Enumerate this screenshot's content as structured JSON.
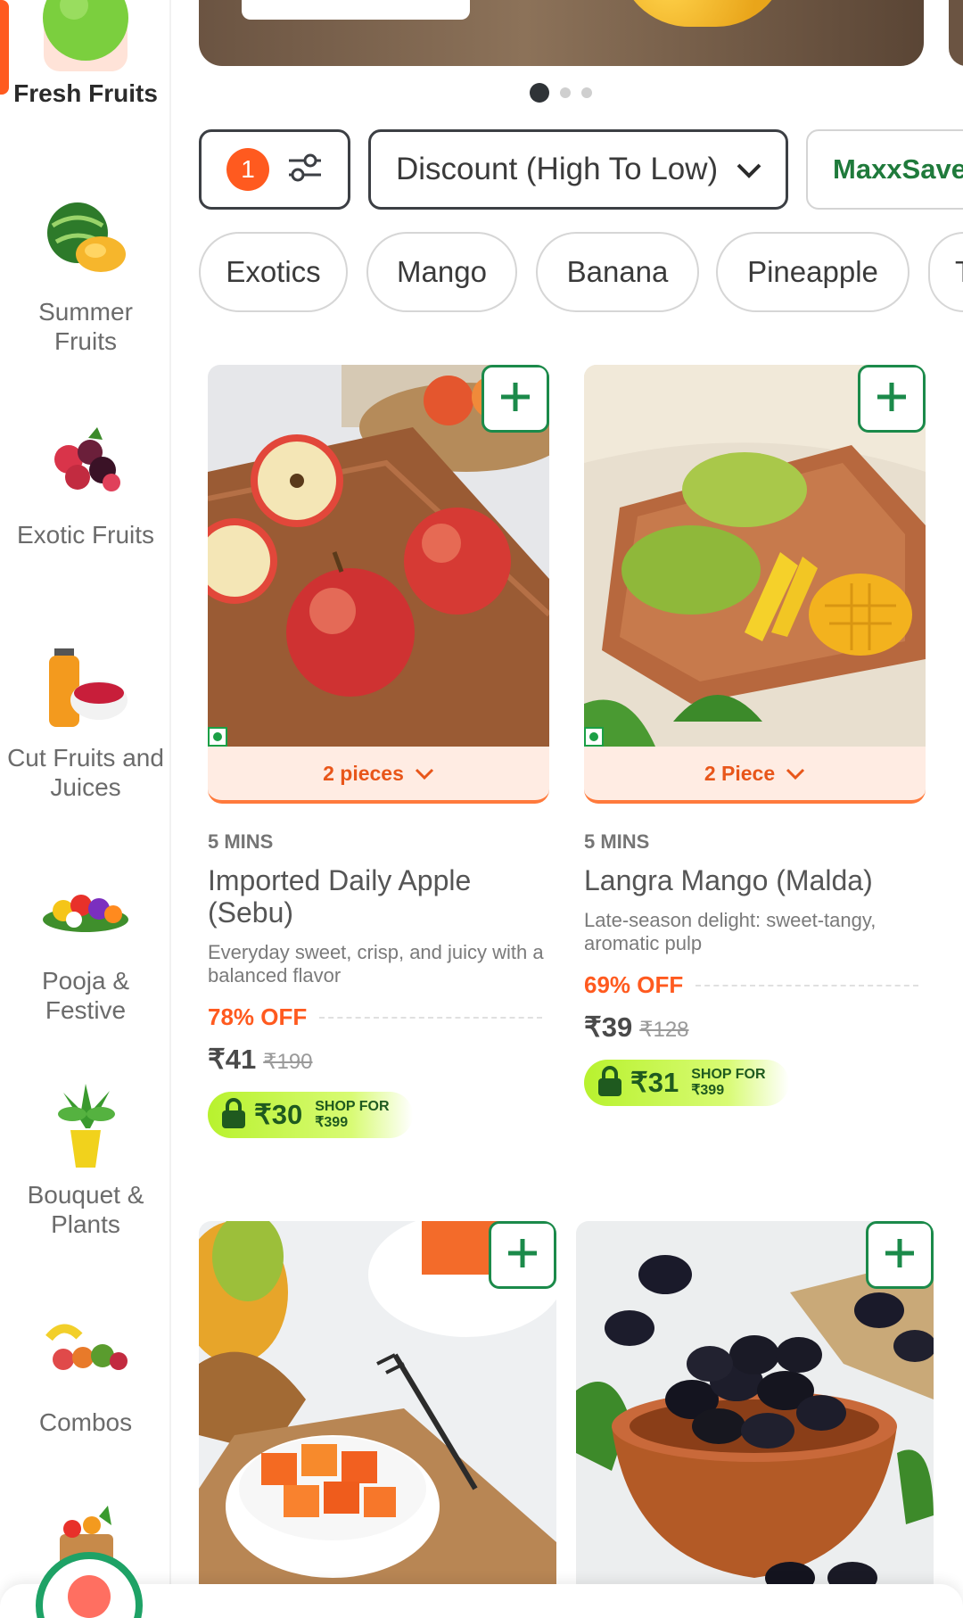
{
  "colors": {
    "accent": "#ff5a1f",
    "green": "#1b8a4a",
    "text": "#3a3a3a"
  },
  "sidebar": {
    "items": [
      {
        "label": "Fresh Fruits",
        "icon": "green-apple-icon",
        "active": true
      },
      {
        "label": "Summer Fruits",
        "icon": "watermelon-mango-icon"
      },
      {
        "label": "Exotic Fruits",
        "icon": "berries-icon"
      },
      {
        "label": "Cut Fruits and Juices",
        "icon": "juice-bowl-icon"
      },
      {
        "label": "Pooja & Festive",
        "icon": "flower-platter-icon"
      },
      {
        "label": "Bouquet & Plants",
        "icon": "potted-plant-icon"
      },
      {
        "label": "Combos",
        "icon": "fruit-combo-icon"
      },
      {
        "label": "",
        "icon": "grocery-bag-icon"
      }
    ]
  },
  "banner": {
    "pagination": {
      "count": 3,
      "active": 0
    }
  },
  "filter": {
    "count": "1",
    "icon": "sliders-icon"
  },
  "sort": {
    "label": "Discount (High To Low)",
    "icon": "chevron-down-icon"
  },
  "maxxsaver": {
    "label": "MaxxSave"
  },
  "chips": [
    "Exotics",
    "Mango",
    "Banana",
    "Pineapple",
    "T"
  ],
  "products": [
    {
      "variant": "2 pieces",
      "eta": "5 MINS",
      "name": "Imported Daily Apple (Sebu)",
      "desc": "Everyday sweet, crisp, and juicy with a balanced flavor",
      "off": "78% OFF",
      "price": "₹41",
      "mrp": "₹190",
      "lock_price": "₹30",
      "lock_shop": "SHOP FOR",
      "lock_min": "₹399"
    },
    {
      "variant": "2 Piece",
      "eta": "5 MINS",
      "name": "Langra Mango (Malda)",
      "desc": "Late-season delight: sweet-tangy, aromatic pulp",
      "off": "69% OFF",
      "price": "₹39",
      "mrp": "₹128",
      "lock_price": "₹31",
      "lock_shop": "SHOP FOR",
      "lock_min": "₹399"
    },
    {
      "image": "papaya-cubes"
    },
    {
      "image": "jamun-bowl"
    }
  ]
}
